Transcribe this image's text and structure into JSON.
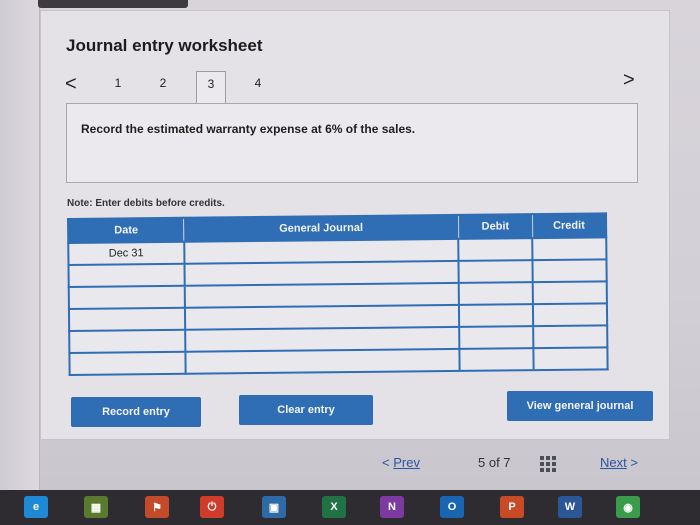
{
  "page": {
    "title": "Journal entry worksheet"
  },
  "tabs": {
    "items": [
      "1",
      "2",
      "3",
      "4"
    ],
    "active_index": 2
  },
  "instruction": {
    "text": "Record the estimated warranty expense at 6% of the sales."
  },
  "note": {
    "text": "Note: Enter debits before credits."
  },
  "journal": {
    "headers": {
      "date": "Date",
      "account": "General Journal",
      "debit": "Debit",
      "credit": "Credit"
    },
    "rows": [
      {
        "date": "Dec 31",
        "account": "",
        "debit": "",
        "credit": ""
      },
      {
        "date": "",
        "account": "",
        "debit": "",
        "credit": ""
      },
      {
        "date": "",
        "account": "",
        "debit": "",
        "credit": ""
      },
      {
        "date": "",
        "account": "",
        "debit": "",
        "credit": ""
      },
      {
        "date": "",
        "account": "",
        "debit": "",
        "credit": ""
      },
      {
        "date": "",
        "account": "",
        "debit": "",
        "credit": ""
      }
    ]
  },
  "buttons": {
    "record": "Record entry",
    "clear": "Clear entry",
    "view": "View general journal"
  },
  "pager": {
    "prev": "Prev",
    "count": "5 of 7",
    "next": "Next"
  },
  "taskbar": {
    "icons": [
      {
        "name": "edge-icon",
        "label": "e",
        "color": "#1e8ad6"
      },
      {
        "name": "calculator-icon",
        "label": "▦",
        "color": "#5a7a2f"
      },
      {
        "name": "store-icon",
        "label": "⚑",
        "color": "#c44b2a"
      },
      {
        "name": "power-icon",
        "label": "⏻",
        "color": "#d03c2a"
      },
      {
        "name": "media-icon",
        "label": "▣",
        "color": "#2d6aa6"
      },
      {
        "name": "excel-icon",
        "label": "X",
        "color": "#207245"
      },
      {
        "name": "onenote-icon",
        "label": "N",
        "color": "#7b3aa0"
      },
      {
        "name": "outlook-icon",
        "label": "O",
        "color": "#1a65b2"
      },
      {
        "name": "powerpoint-icon",
        "label": "P",
        "color": "#c94a26"
      },
      {
        "name": "word-icon",
        "label": "W",
        "color": "#2b5797"
      },
      {
        "name": "chrome-icon",
        "label": "◉",
        "color": "#3a9b4a"
      }
    ]
  }
}
